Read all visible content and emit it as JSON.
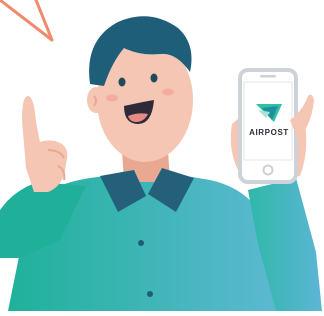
{
  "illustration": {
    "app_name": "AIRPOST",
    "colors": {
      "shirt_start": "#20b39a",
      "shirt_end": "#5fb9d3",
      "collar": "#24607a",
      "hair": "#1f5e78",
      "skin": "#f4c6b3",
      "skin_shadow": "#e8a891",
      "mouth": "#2f2a3a",
      "speech_mark": "#f08a6e",
      "phone_frame": "#cdd2d8",
      "logo_teal": "#2ec2a3"
    }
  }
}
